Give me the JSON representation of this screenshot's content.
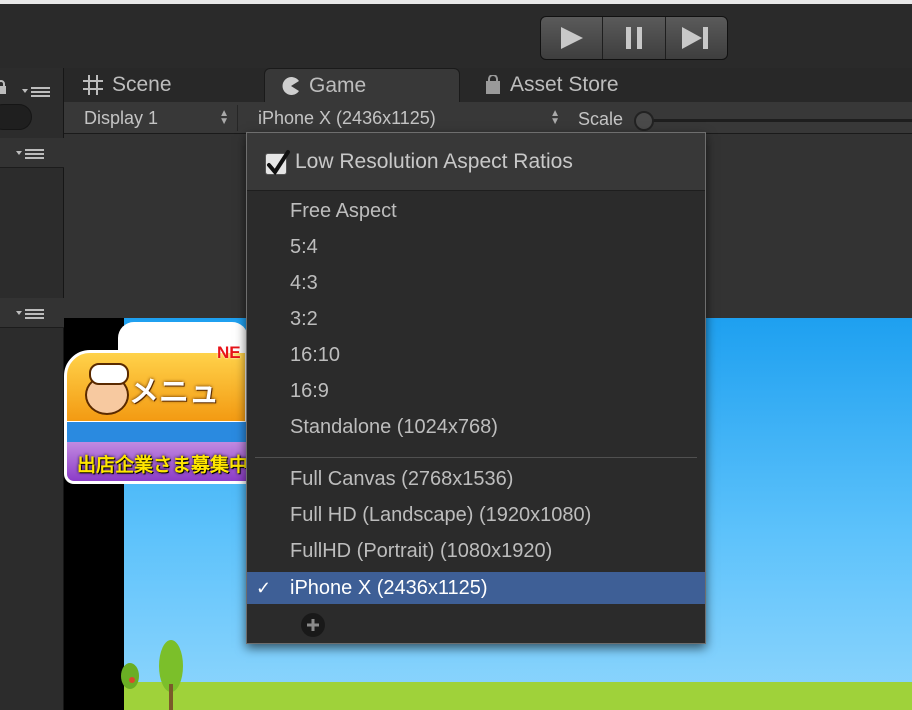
{
  "toolbar": {
    "play_icon": "play-icon",
    "pause_icon": "pause-icon",
    "step_icon": "step-icon"
  },
  "tabs": {
    "scene": "Scene",
    "game": "Game",
    "asset_store": "Asset Store"
  },
  "game_toolbar": {
    "display": "Display 1",
    "resolution": "iPhone X (2436x1125)",
    "scale_label": "Scale"
  },
  "game_view": {
    "menu_label": "メニュー",
    "new_badge": "NE",
    "recruit_label": "出店企業さま募集中"
  },
  "dropdown": {
    "low_res_label": "Low Resolution Aspect Ratios",
    "low_res_checked": true,
    "items": [
      "Free Aspect",
      "5:4",
      "4:3",
      "3:2",
      "16:10",
      "16:9",
      "Standalone (1024x768)"
    ],
    "custom_items": [
      "Full Canvas (2768x1536)",
      "Full HD (Landscape) (1920x1080)",
      "FullHD (Portrait) (1080x1920)",
      "iPhone X (2436x1125)"
    ],
    "selected": "iPhone X (2436x1125)",
    "selected_check": "✓",
    "add_icon": "plus-icon"
  },
  "colors": {
    "selection": "#3e5f96",
    "sky": "#5dc2fb",
    "grass": "#9fd23a"
  }
}
